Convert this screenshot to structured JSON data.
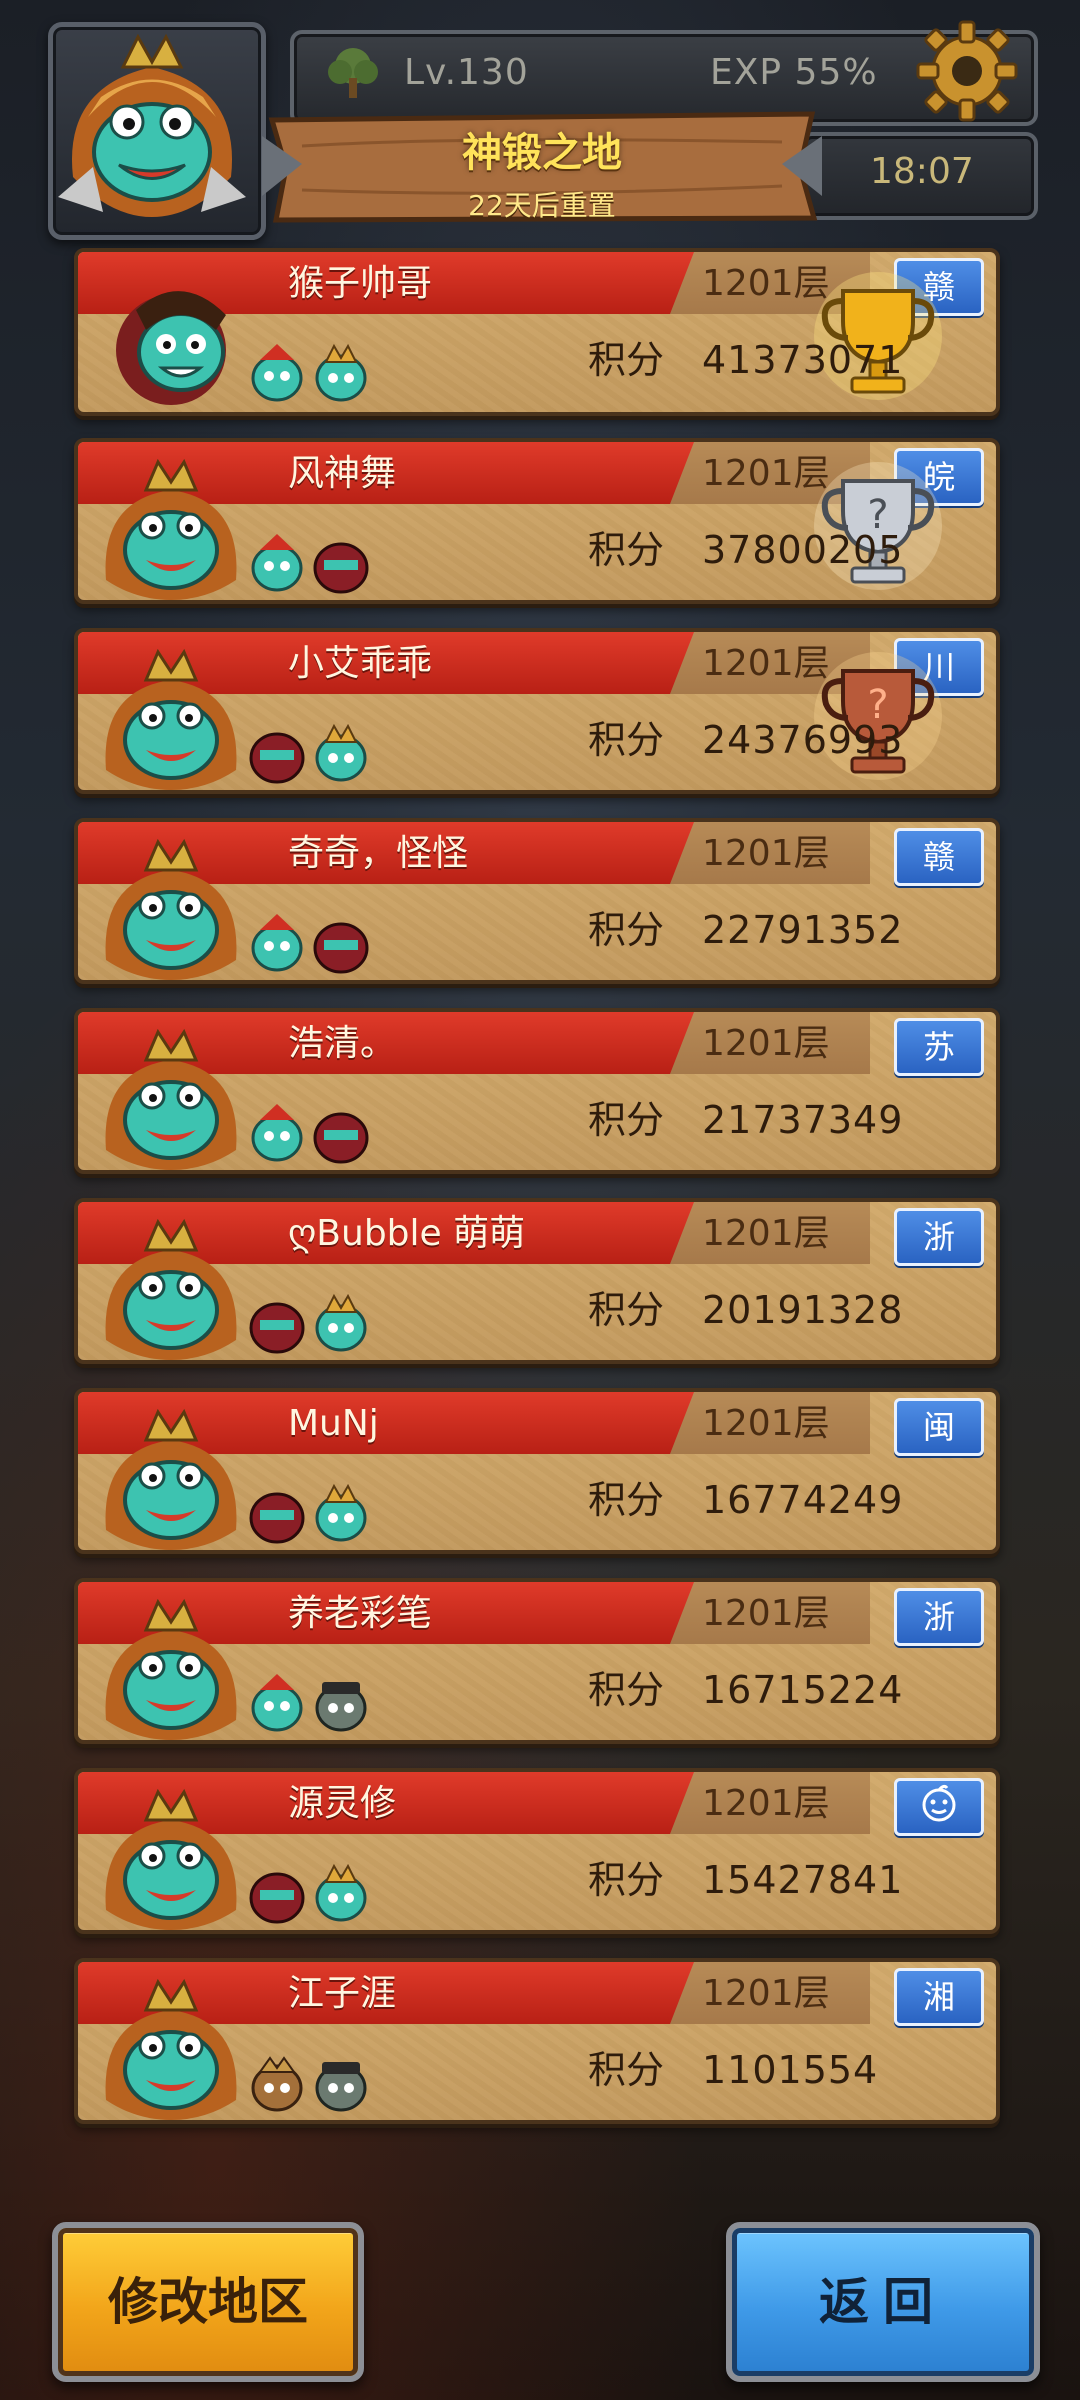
{
  "header": {
    "level": "Lv.130",
    "exp": "EXP 55%",
    "title": "神锻之地",
    "reset_note": "22天后重置",
    "time": "18:07"
  },
  "leaderboard": {
    "score_label": "积分",
    "rows": [
      {
        "name": "猴子帅哥",
        "floor": "1201层",
        "score": "41373071",
        "region": "赣",
        "trophy": "gold"
      },
      {
        "name": "风神舞",
        "floor": "1201层",
        "score": "37800205",
        "region": "皖",
        "trophy": "silver"
      },
      {
        "name": "小艾乖乖",
        "floor": "1201层",
        "score": "24376993",
        "region": "川",
        "trophy": "bronze"
      },
      {
        "name": "奇奇，怪怪",
        "floor": "1201层",
        "score": "22791352",
        "region": "赣",
        "trophy": ""
      },
      {
        "name": "浩清。",
        "floor": "1201层",
        "score": "21737349",
        "region": "苏",
        "trophy": ""
      },
      {
        "name": "ღBubble 萌萌",
        "floor": "1201层",
        "score": "20191328",
        "region": "浙",
        "trophy": ""
      },
      {
        "name": "MuNj",
        "floor": "1201层",
        "score": "16774249",
        "region": "闽",
        "trophy": ""
      },
      {
        "name": "养老彩笔",
        "floor": "1201层",
        "score": "16715224",
        "region": "浙",
        "trophy": ""
      },
      {
        "name": "源灵修",
        "floor": "1201层",
        "score": "15427841",
        "region": "",
        "trophy": ""
      },
      {
        "name": "江子涯",
        "floor": "1201层",
        "score": "1101554",
        "region": "湘",
        "trophy": ""
      }
    ]
  },
  "buttons": {
    "change_region": "修改地区",
    "back": "返回"
  },
  "colors": {
    "ribbon": "#d02f22",
    "card": "#c9a164",
    "gold": "#f1b21b",
    "blue_button": "#3f9ae8"
  }
}
